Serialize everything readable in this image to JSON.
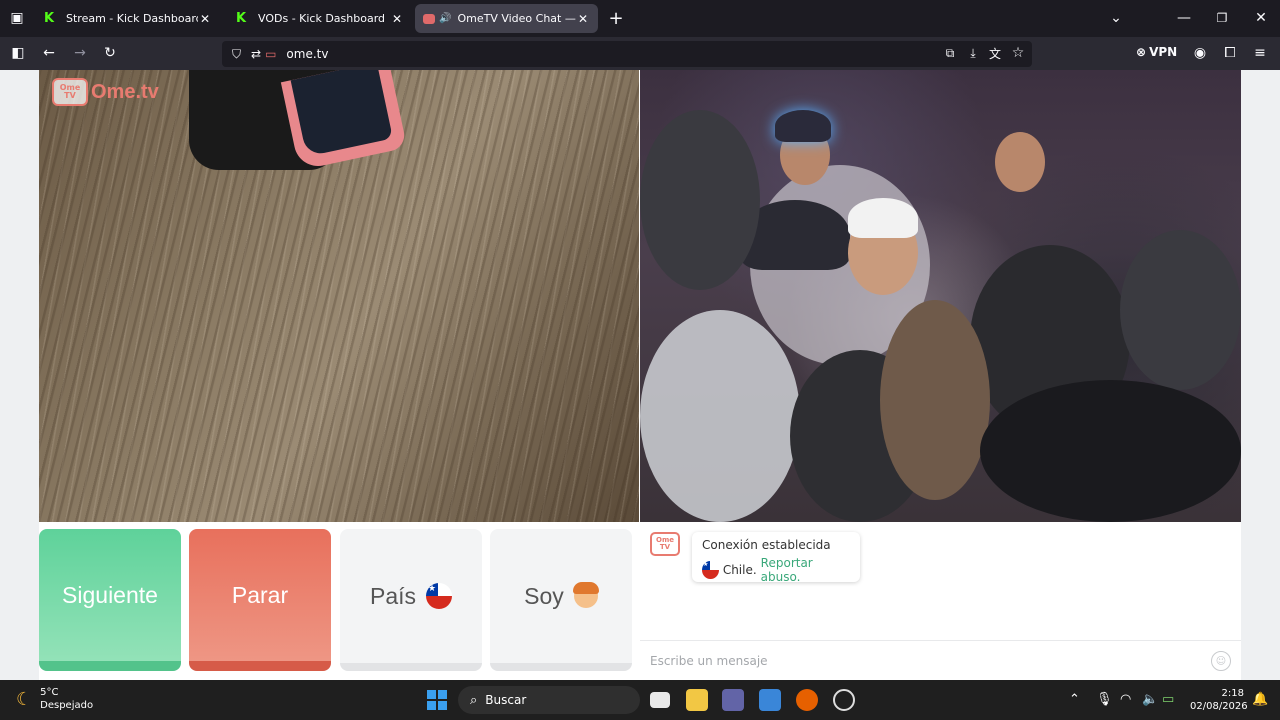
{
  "browser": {
    "tabs": [
      {
        "title": "Stream - Kick Dashboard",
        "active": false
      },
      {
        "title": "VODs - Kick Dashboard",
        "active": false
      },
      {
        "title": "OmeTV Video Chat — Ome",
        "active": true
      }
    ],
    "url": "ome.tv",
    "vpn_label": "VPN"
  },
  "site": {
    "logo_tv": "Ome TV",
    "logo_text": "Ome.tv"
  },
  "controls": {
    "next_label": "Siguiente",
    "stop_label": "Parar",
    "country_label": "País",
    "gender_label": "Soy"
  },
  "chat": {
    "logo_tv": "Ome TV",
    "status": "Conexión establecida",
    "country": "Chile.",
    "report_link": "Reportar abuso.",
    "input_placeholder": "Escribe un mensaje"
  },
  "taskbar": {
    "temperature": "5°C",
    "weather": "Despejado",
    "search_label": "Buscar",
    "time": "2:18",
    "date": "02/08/2026"
  },
  "colors": {
    "next": "#5ed29a",
    "stop": "#e8705c",
    "brand": "#e87b70",
    "report": "#3aa87a"
  }
}
